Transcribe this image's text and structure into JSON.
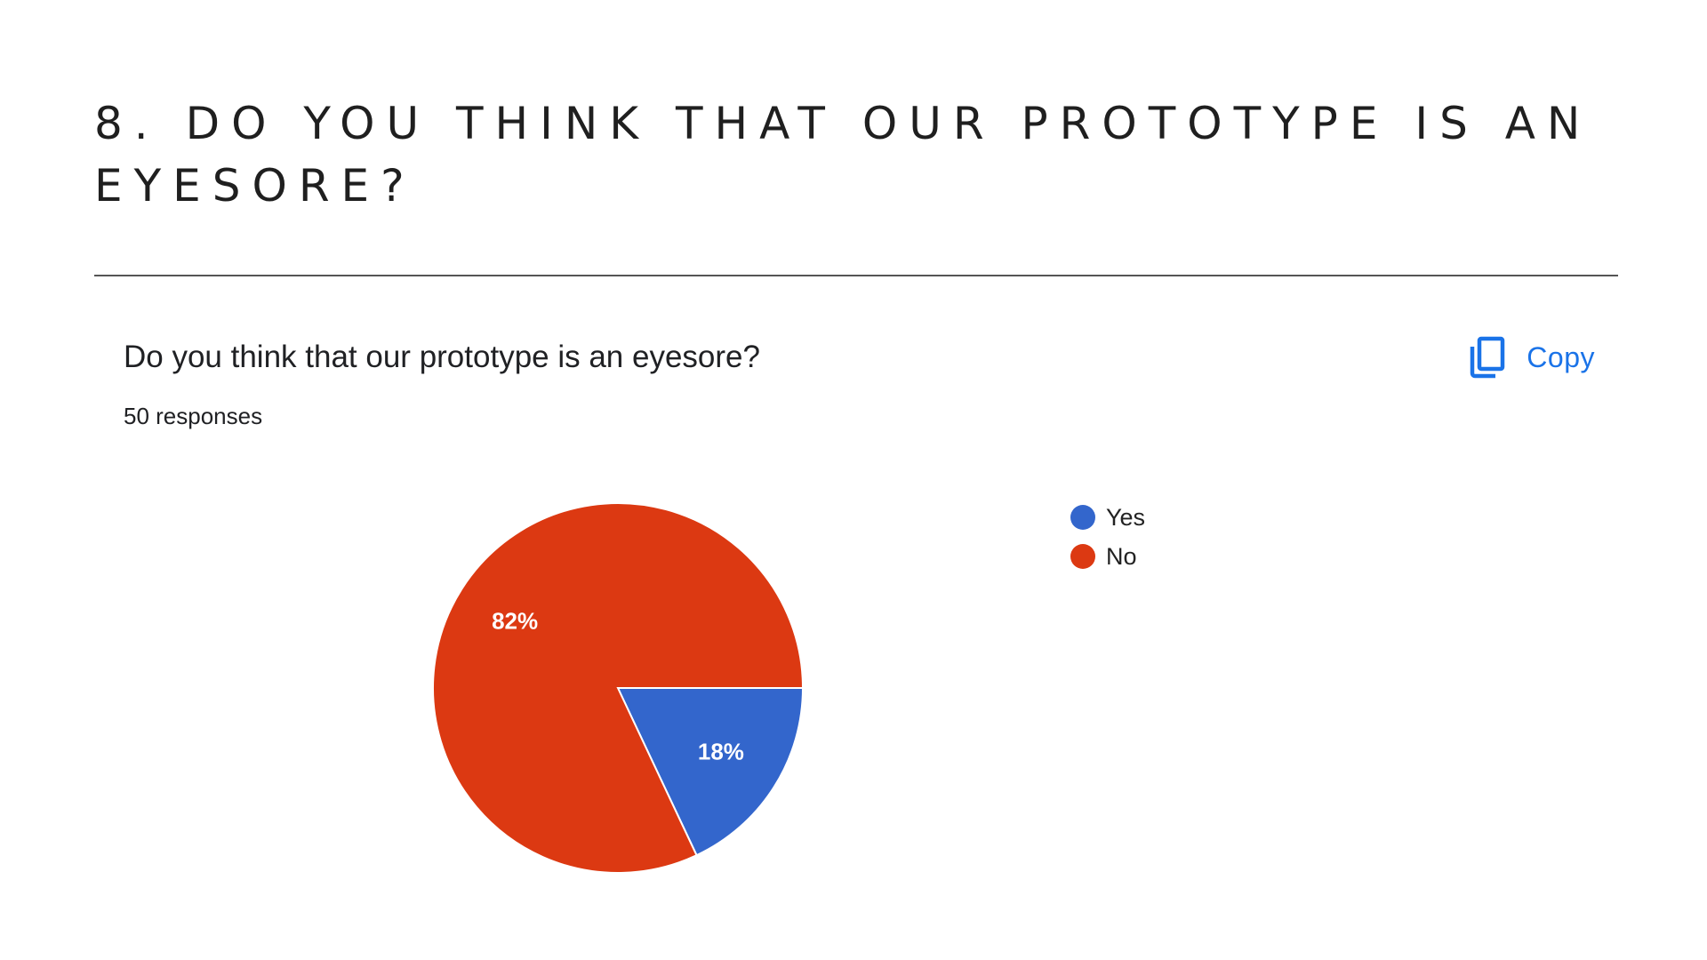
{
  "slide": {
    "title": "8. Do you think that our prototype is an eyesore?"
  },
  "card": {
    "question": "Do you think that our prototype is an eyesore?",
    "responses": "50 responses",
    "copy_label": "Copy"
  },
  "chart_data": {
    "type": "pie",
    "title": "",
    "categories": [
      "Yes",
      "No"
    ],
    "values": [
      18,
      82
    ],
    "labels": [
      "18%",
      "82%"
    ],
    "colors": [
      "#3366cc",
      "#dc3912"
    ],
    "start": "3 o'clock",
    "direction": "clockwise",
    "legend": "right"
  },
  "colors": {
    "accent": "#1a73e8",
    "divider": "#555555",
    "text": "#202124"
  },
  "icons": {
    "copy": "copy-icon"
  }
}
